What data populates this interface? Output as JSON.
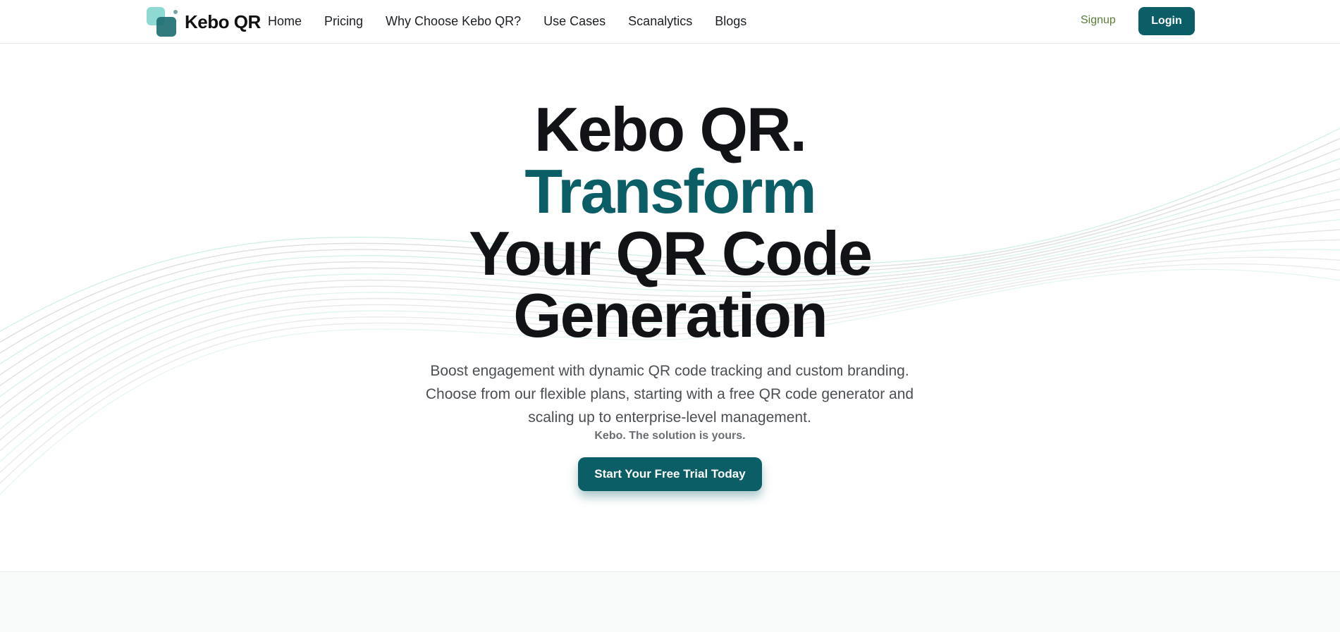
{
  "brand": {
    "name": "Kebo QR",
    "icon": "kebo-logo-icon"
  },
  "nav": {
    "links": [
      "Home",
      "Pricing",
      "Why Choose Kebo QR?",
      "Use Cases",
      "Scanalytics",
      "Blogs"
    ],
    "signup_label": "Signup",
    "login_label": "Login"
  },
  "hero": {
    "headline_line1": "Kebo QR.",
    "headline_line2": "Transform",
    "headline_line3": "Your QR Code",
    "headline_line4": "Generation",
    "subtitle_line1": "Boost engagement with dynamic QR code tracking and custom branding.",
    "subtitle_line2": "Choose from our flexible plans, starting with a free QR code generator and",
    "subtitle_line3": "scaling up to enterprise-level management.",
    "tagline": "Kebo. The solution is yours.",
    "cta_label": "Start Your Free Trial Today"
  },
  "colors": {
    "accent": "#0b5e66",
    "signup": "#5b7d3a",
    "text": "#111317",
    "muted": "#4b4f54"
  }
}
